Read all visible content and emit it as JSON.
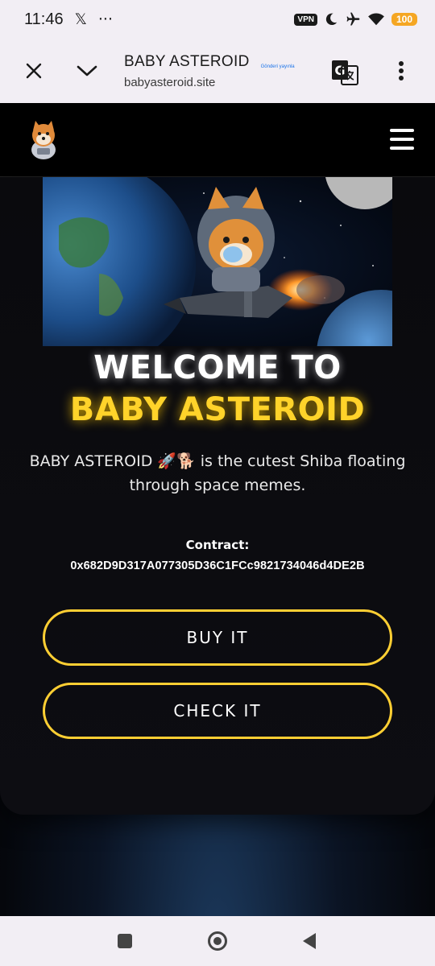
{
  "status_bar": {
    "time": "11:46",
    "x_icon": "𝕏",
    "more": "···",
    "vpn": "VPN",
    "battery": "100"
  },
  "browser": {
    "title": "BABY ASTEROID",
    "url": "babyasteroid.site",
    "publish_label": "Gönderi yayınla"
  },
  "site": {
    "welcome_line1": "WELCOME TO",
    "welcome_line2": "BABY ASTEROID",
    "tagline": "BABY ASTEROID 🚀🐕 is the cutest Shiba floating through space memes.",
    "contract_label": "Contract:",
    "contract_address": "0x682D9D317A077305D36C1FCc9821734046d4DE2B",
    "buy_label": "BUY IT",
    "check_label": "CHECK IT"
  },
  "colors": {
    "accent_yellow": "#ffd32a",
    "button_border": "#ffcf33",
    "background": "#000000"
  },
  "icons": {
    "close": "close-icon",
    "collapse": "chevron-down-icon",
    "translate": "translate-icon",
    "menu": "more-vert-icon",
    "hamburger": "hamburger-menu-icon"
  }
}
